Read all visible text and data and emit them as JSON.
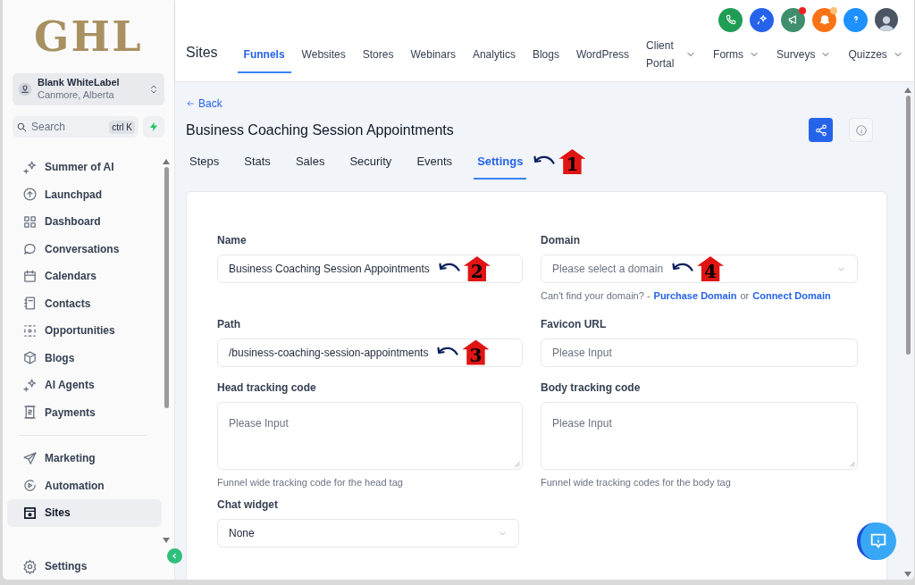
{
  "logo": {
    "text": "GHL"
  },
  "account": {
    "name": "Blank WhiteLabel",
    "location": "Canmore, Alberta"
  },
  "search": {
    "placeholder": "Search",
    "shortcut": "ctrl K"
  },
  "sidebar": {
    "groups": [
      [
        {
          "label": "Summer of AI",
          "selected": false
        },
        {
          "label": "Launchpad",
          "selected": false
        },
        {
          "label": "Dashboard",
          "selected": false
        },
        {
          "label": "Conversations",
          "selected": false
        },
        {
          "label": "Calendars",
          "selected": false
        },
        {
          "label": "Contacts",
          "selected": false
        },
        {
          "label": "Opportunities",
          "selected": false
        },
        {
          "label": "Blogs",
          "selected": false
        },
        {
          "label": "AI Agents",
          "selected": false
        },
        {
          "label": "Payments",
          "selected": false
        }
      ],
      [
        {
          "label": "Marketing",
          "selected": false
        },
        {
          "label": "Automation",
          "selected": false
        },
        {
          "label": "Sites",
          "selected": true
        }
      ]
    ],
    "footer_item": {
      "label": "Settings"
    }
  },
  "header": {
    "title": "Sites",
    "tabs": [
      {
        "label": "Funnels",
        "selected": true,
        "dropdown": false
      },
      {
        "label": "Websites",
        "selected": false,
        "dropdown": false
      },
      {
        "label": "Stores",
        "selected": false,
        "dropdown": false
      },
      {
        "label": "Webinars",
        "selected": false,
        "dropdown": false
      },
      {
        "label": "Analytics",
        "selected": false,
        "dropdown": false
      },
      {
        "label": "Blogs",
        "selected": false,
        "dropdown": false
      },
      {
        "label": "WordPress",
        "selected": false,
        "dropdown": false
      },
      {
        "label": "Client Portal",
        "selected": false,
        "dropdown": true
      },
      {
        "label": "Forms",
        "selected": false,
        "dropdown": true
      },
      {
        "label": "Surveys",
        "selected": false,
        "dropdown": true
      },
      {
        "label": "Quizzes",
        "selected": false,
        "dropdown": true
      }
    ]
  },
  "page": {
    "back": "Back",
    "title": "Business Coaching Session Appointments",
    "tabs": [
      {
        "label": "Steps",
        "selected": false
      },
      {
        "label": "Stats",
        "selected": false
      },
      {
        "label": "Sales",
        "selected": false
      },
      {
        "label": "Security",
        "selected": false
      },
      {
        "label": "Events",
        "selected": false
      },
      {
        "label": "Settings",
        "selected": true,
        "annotation": "1"
      }
    ]
  },
  "form": {
    "fields": [
      {
        "label": "Name",
        "kind": "input",
        "value": "Business Coaching Session Appointments",
        "annotation": "2"
      },
      {
        "label": "Domain",
        "kind": "select",
        "placeholder": "Please select a domain",
        "annotation": "4",
        "help": [
          {
            "kind": "text",
            "text": "Can't find your domain? -"
          },
          {
            "kind": "link",
            "text": "Purchase Domain"
          },
          {
            "kind": "text",
            "text": "or"
          },
          {
            "kind": "link",
            "text": "Connect Domain"
          }
        ]
      },
      {
        "label": "Path",
        "kind": "input",
        "value": "/business-coaching-session-appointments",
        "annotation": "3"
      },
      {
        "label": "Favicon URL",
        "kind": "input",
        "placeholder": "Please Input"
      },
      {
        "label": "Head tracking code",
        "kind": "textarea",
        "placeholder": "Please Input",
        "help": [
          {
            "kind": "text",
            "text": "Funnel wide tracking code for the head tag"
          }
        ]
      },
      {
        "label": "Body tracking code",
        "kind": "textarea",
        "placeholder": "Please Input",
        "help": [
          {
            "kind": "text",
            "text": "Funnel wide tracking codes for the body tag"
          }
        ]
      },
      {
        "label": "Chat widget",
        "kind": "select",
        "value": "None"
      }
    ]
  }
}
